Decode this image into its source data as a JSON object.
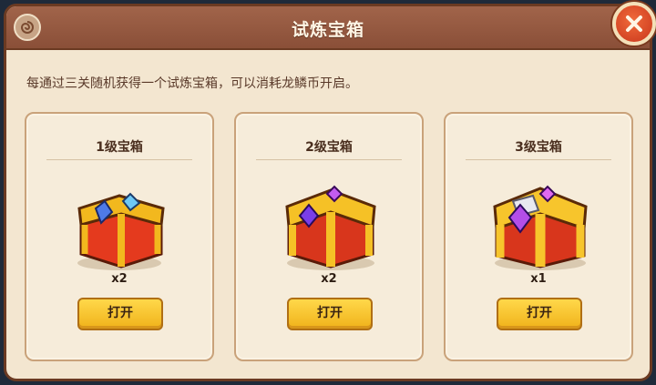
{
  "dialog": {
    "title": "试炼宝箱",
    "description": "每通过三关随机获得一个试炼宝箱，可以消耗龙鳞币开启。"
  },
  "chests": [
    {
      "title": "1级宝箱",
      "count": "x2",
      "button_label": "打开"
    },
    {
      "title": "2级宝箱",
      "count": "x2",
      "button_label": "打开"
    },
    {
      "title": "3级宝箱",
      "count": "x1",
      "button_label": "打开"
    }
  ],
  "colors": {
    "header": "#8a4f38",
    "panel": "#f3e6d0",
    "button": "#f0b21a",
    "close": "#d9441f"
  }
}
